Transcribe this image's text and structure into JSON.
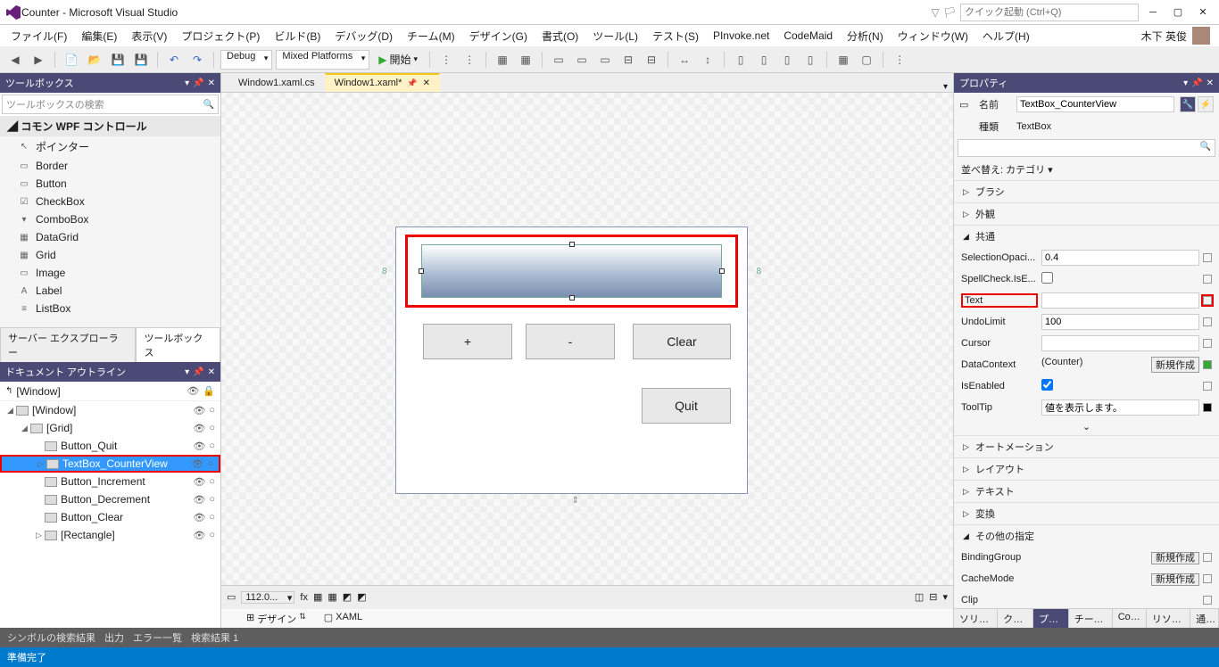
{
  "window": {
    "title": "Counter - Microsoft Visual Studio",
    "quick_launch_placeholder": "クイック起動 (Ctrl+Q)"
  },
  "menu": {
    "file": "ファイル(F)",
    "edit": "編集(E)",
    "view": "表示(V)",
    "project": "プロジェクト(P)",
    "build": "ビルド(B)",
    "debug": "デバッグ(D)",
    "team": "チーム(M)",
    "design": "デザイン(G)",
    "format": "書式(O)",
    "tools": "ツール(L)",
    "test": "テスト(S)",
    "pinvoke": "PInvoke.net",
    "codemaid": "CodeMaid",
    "analyze": "分析(N)",
    "window": "ウィンドウ(W)",
    "help": "ヘルプ(H)",
    "user": "木下 英俊"
  },
  "toolbar": {
    "config": "Debug",
    "platform": "Mixed Platforms",
    "run": "開始"
  },
  "toolbox": {
    "title": "ツールボックス",
    "search_placeholder": "ツールボックスの検索",
    "group": "コモン WPF コントロール",
    "items": [
      {
        "icon": "↖",
        "label": "ポインター"
      },
      {
        "icon": "▭",
        "label": "Border"
      },
      {
        "icon": "▭",
        "label": "Button"
      },
      {
        "icon": "☑",
        "label": "CheckBox"
      },
      {
        "icon": "▾",
        "label": "ComboBox"
      },
      {
        "icon": "▦",
        "label": "DataGrid"
      },
      {
        "icon": "▦",
        "label": "Grid"
      },
      {
        "icon": "▭",
        "label": "Image"
      },
      {
        "icon": "A",
        "label": "Label"
      },
      {
        "icon": "≡",
        "label": "ListBox"
      }
    ],
    "tabs": {
      "server_explorer": "サーバー エクスプローラー",
      "toolbox": "ツールボックス"
    }
  },
  "outline": {
    "title": "ドキュメント アウトライン",
    "root": "[Window]",
    "items": [
      {
        "depth": 0,
        "toggle": "◢",
        "label": "[Window]"
      },
      {
        "depth": 1,
        "toggle": "◢",
        "label": "[Grid]"
      },
      {
        "depth": 2,
        "toggle": "",
        "label": "Button_Quit"
      },
      {
        "depth": 2,
        "toggle": "▷",
        "label": "TextBox_CounterView",
        "selected": true,
        "hl": true
      },
      {
        "depth": 2,
        "toggle": "",
        "label": "Button_Increment"
      },
      {
        "depth": 2,
        "toggle": "",
        "label": "Button_Decrement"
      },
      {
        "depth": 2,
        "toggle": "",
        "label": "Button_Clear"
      },
      {
        "depth": 2,
        "toggle": "▷",
        "label": "[Rectangle]"
      }
    ]
  },
  "doctabs": {
    "tab1": "Window1.xaml.cs",
    "tab2": "Window1.xaml*"
  },
  "designer": {
    "margin_left": "8",
    "margin_right": "8",
    "btn_plus": "+",
    "btn_minus": "-",
    "btn_clear": "Clear",
    "btn_quit": "Quit",
    "zoom": "112.0...",
    "tab_design": "デザイン",
    "tab_xaml": "XAML"
  },
  "properties": {
    "title": "プロパティ",
    "name_label": "名前",
    "name_value": "TextBox_CounterView",
    "type_label": "種類",
    "type_value": "TextBox",
    "sort_label": "並べ替え: カテゴリ ▾",
    "cats": {
      "brush": "ブラシ",
      "appearance": "外観",
      "common": "共通",
      "automation": "オートメーション",
      "layout": "レイアウト",
      "text": "テキスト",
      "transform": "変換",
      "misc": "その他の指定"
    },
    "common": {
      "selectionopacity_label": "SelectionOpaci...",
      "selectionopacity_value": "0.4",
      "spellcheck_label": "SpellCheck.IsE...",
      "text_label": "Text",
      "text_value": "",
      "undolimit_label": "UndoLimit",
      "undolimit_value": "100",
      "cursor_label": "Cursor",
      "datacontext_label": "DataContext",
      "datacontext_value": "(Counter)",
      "datacontext_btn": "新規作成",
      "isenabled_label": "IsEnabled",
      "tooltip_label": "ToolTip",
      "tooltip_value": "値を表示します。"
    },
    "misc": {
      "bindinggroup_label": "BindingGroup",
      "bindinggroup_btn": "新規作成",
      "cachemode_label": "CacheMode",
      "cachemode_btn": "新規作成",
      "clip_label": "Clip"
    },
    "tabs": {
      "solution": "ソリュ...",
      "class": "クラ...",
      "properties": "プロ...",
      "team": "チーム...",
      "code": "Cod...",
      "resource": "リソー...",
      "notify": "通知"
    }
  },
  "bottom": {
    "find_symbol": "シンボルの検索結果",
    "output": "出力",
    "error_list": "エラー一覧",
    "find_results": "検索結果 1",
    "status": "準備完了"
  }
}
